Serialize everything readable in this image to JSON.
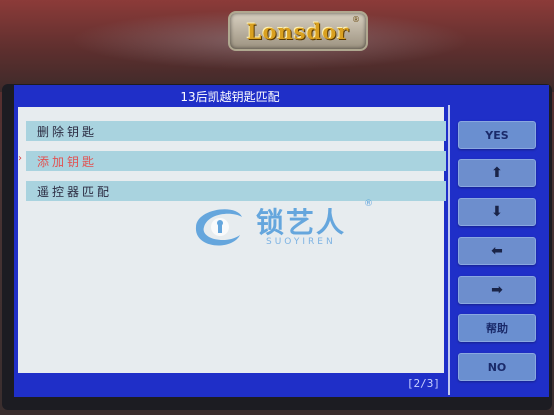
{
  "device": {
    "brand_logo": "Lonsdor",
    "logo_reg_mark": "®"
  },
  "screen": {
    "title": "13后凯越钥匙匹配",
    "menu": [
      {
        "label": "删除钥匙",
        "selected": false
      },
      {
        "label": "添加钥匙",
        "selected": true
      },
      {
        "label": "遥控器匹配",
        "selected": false
      }
    ],
    "cursor_glyph": "›",
    "page_indicator": "[2/3]"
  },
  "side_buttons": [
    {
      "label": "YES",
      "icon": ""
    },
    {
      "label": "",
      "icon": "arrow-up-icon",
      "glyph": "⬆"
    },
    {
      "label": "",
      "icon": "arrow-down-icon",
      "glyph": "⬇"
    },
    {
      "label": "",
      "icon": "arrow-left-icon",
      "glyph": "⬅"
    },
    {
      "label": "",
      "icon": "arrow-right-icon",
      "glyph": "➡"
    },
    {
      "label": "帮助",
      "icon": ""
    },
    {
      "label": "NO",
      "icon": ""
    }
  ],
  "watermark": {
    "text": "锁艺人",
    "sub": "SUOYIREN",
    "reg": "®"
  },
  "colors": {
    "screen_blue": "#1f2fc8",
    "row_highlight": "#a9d3df",
    "selected_text": "#e25252",
    "button_blue": "#6a8fd0"
  }
}
